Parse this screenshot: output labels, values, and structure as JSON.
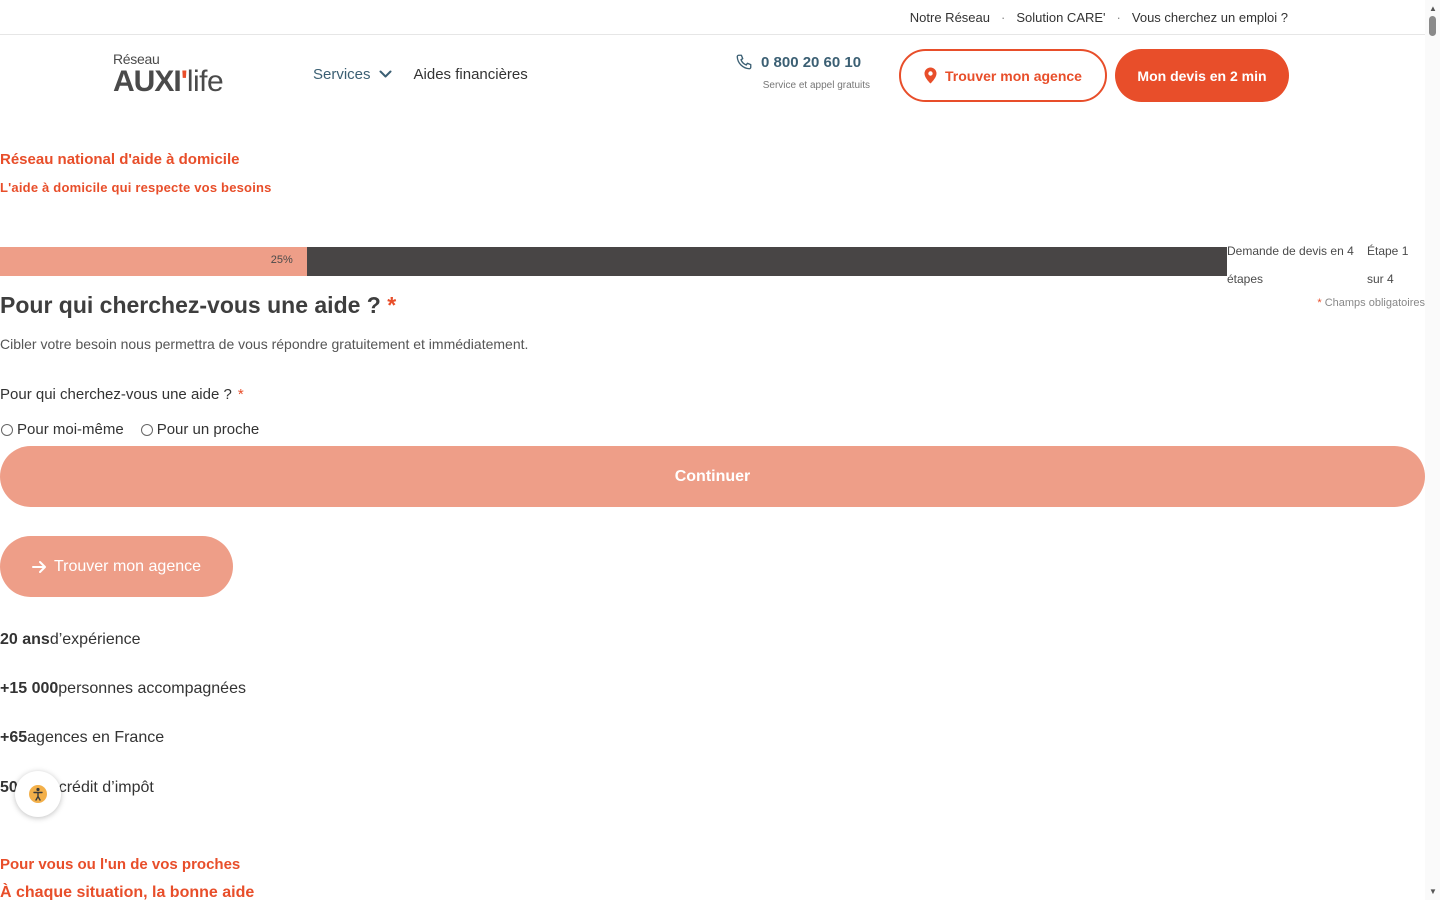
{
  "topbar": {
    "links": [
      "Notre Réseau",
      "Solution CARE'",
      "Vous cherchez un emploi ?"
    ],
    "separator": "·"
  },
  "logo": {
    "small": "Réseau",
    "brand": "AUXI",
    "tick": "'",
    "suffix": "life"
  },
  "nav": {
    "services": "Services",
    "aides": "Aides financières"
  },
  "phone": {
    "number": "0 800 20 60 10",
    "subtitle": "Service et appel gratuits"
  },
  "header_buttons": {
    "find_agency": "Trouver mon agence",
    "quote": "Mon devis en 2 min"
  },
  "hero": {
    "kicker": "Réseau national d'aide à domicile",
    "title": "L'aide à domicile qui respecte vos besoins"
  },
  "progress": {
    "value": 0.25,
    "label": "25%",
    "steps_title": "Demande de devis en 4 étapes",
    "step": "Étape 1 sur 4"
  },
  "form": {
    "required_star": "*",
    "required_note": "Champs obligatoires",
    "title": "Pour qui cherchez-vous une aide ?",
    "description": "Cibler votre besoin nous permettra de vous répondre gratuitement et immédiatement.",
    "question": "Pour qui cherchez-vous une aide ?",
    "options": [
      "Pour moi-même",
      "Pour un proche"
    ],
    "continue": "Continuer"
  },
  "agency_button": "Trouver mon agence",
  "stats": [
    {
      "value": "20 ans",
      "label": "d’expérience"
    },
    {
      "value": "+15 000",
      "label": "personnes accompagnées"
    },
    {
      "value": "+65",
      "label": "agences en France"
    },
    {
      "value": "50 %",
      "label": "de crédit d’impôt"
    }
  ],
  "section": {
    "kicker": "Pour vous ou l'un de vos proches",
    "title": "À chaque situation, la bonne aide"
  },
  "colors": {
    "accent": "#e84e2a",
    "accent_light": "#ee9e88",
    "nav_blue": "#3b5f73",
    "progress_track": "#484545"
  },
  "icons": [
    "phone-icon",
    "location-pin-icon",
    "chevron-down-icon",
    "arrow-right-icon",
    "accessibility-icon"
  ]
}
